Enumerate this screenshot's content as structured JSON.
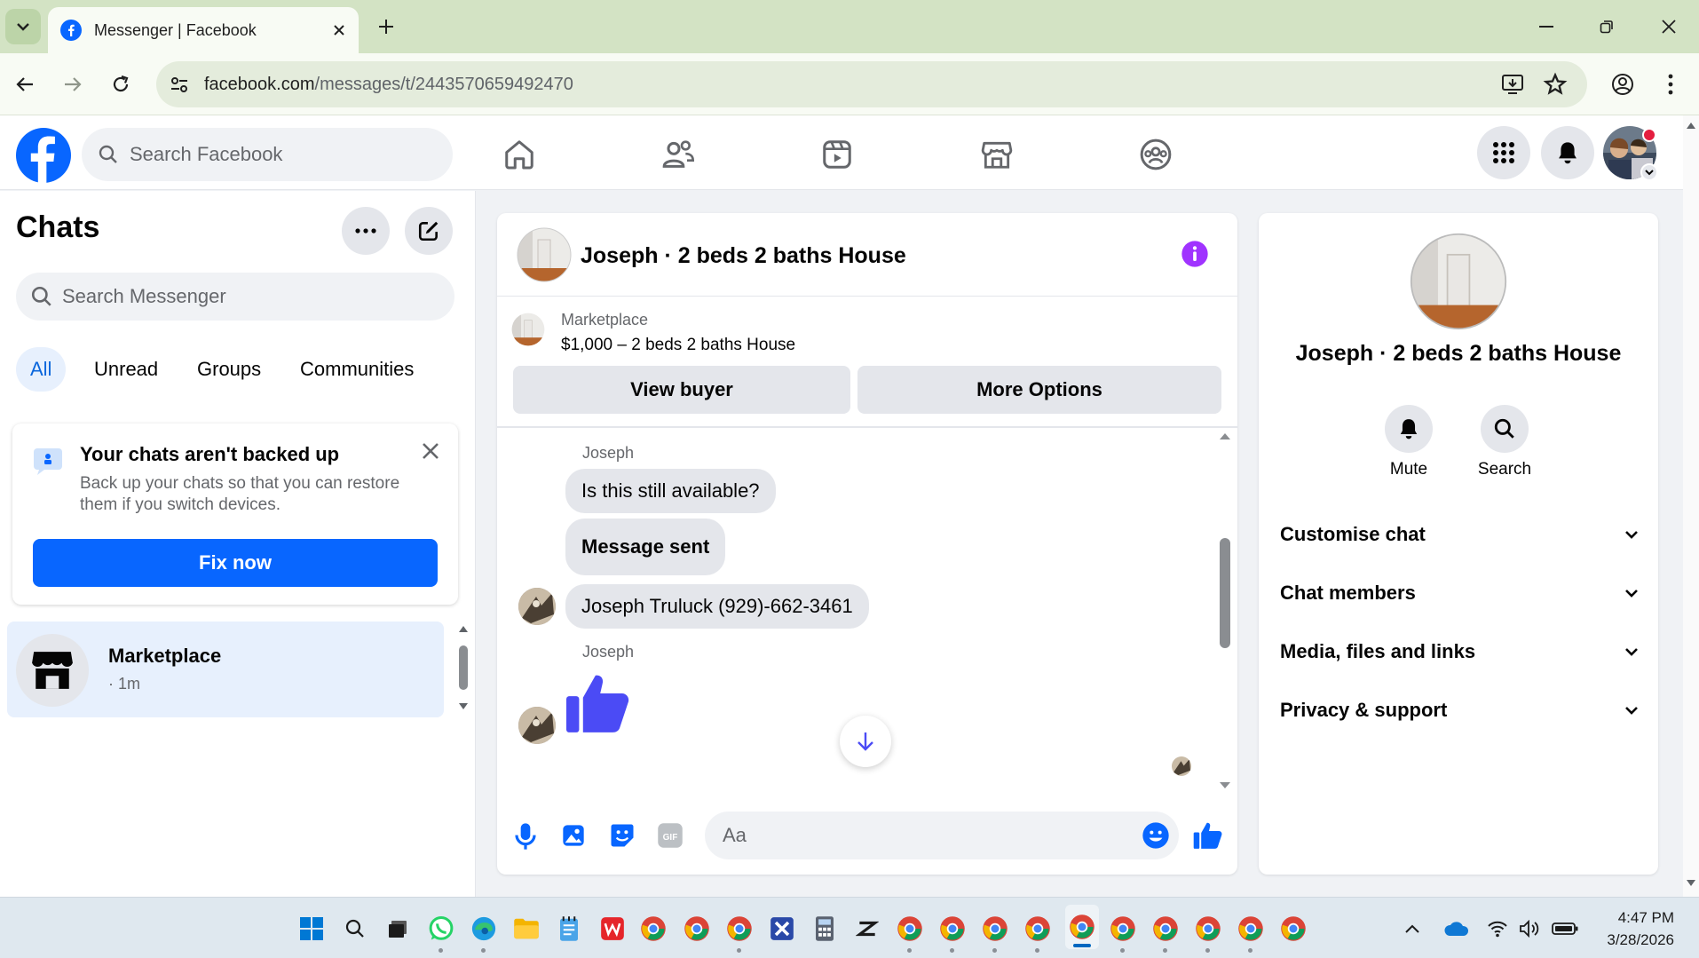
{
  "browser": {
    "tab_title": "Messenger | Facebook",
    "url_domain": "facebook.com",
    "url_path": "/messages/t/2443570659492470",
    "colors": {
      "chrome": "#d3e3c4",
      "toolbar": "#f8fbf4"
    }
  },
  "facebook": {
    "search_placeholder": "Search Facebook",
    "nav_icons": [
      "home-icon",
      "friends-icon",
      "video-icon",
      "marketplace-icon",
      "groups-icon"
    ],
    "brand_color": "#0866ff"
  },
  "sidebar": {
    "title": "Chats",
    "search_placeholder": "Search Messenger",
    "filters": [
      "All",
      "Unread",
      "Groups",
      "Communities"
    ],
    "active_filter": "All",
    "backup_card": {
      "heading": "Your chats aren't backed up",
      "description": "Back up your chats so that you can restore them if you switch devices.",
      "button": "Fix now"
    },
    "chat_items": [
      {
        "name": "Marketplace",
        "meta": "· 1m"
      }
    ]
  },
  "conversation": {
    "title": "Joseph · 2 beds 2 baths House",
    "marketplace_label": "Marketplace",
    "listing": "$1,000 – 2 beds 2 baths House",
    "view_buyer": "View buyer",
    "more_options": "More Options",
    "messages": [
      {
        "sender": "Joseph",
        "text": "Is this still available?"
      },
      {
        "sender": "",
        "text": "Message sent"
      },
      {
        "sender": "",
        "text": "Joseph Truluck (929)-662-3461"
      },
      {
        "sender": "Joseph",
        "text": "thumbs-up"
      }
    ],
    "composer_placeholder": "Aa",
    "accent_color": "#4b4bf5"
  },
  "details": {
    "name": "Joseph · 2 beds 2 baths House",
    "actions": [
      "Mute",
      "Search"
    ],
    "sections": [
      "Customise chat",
      "Chat members",
      "Media, files and links",
      "Privacy & support"
    ]
  },
  "taskbar": {
    "time": "4:47 PM",
    "date": "3/28/2026"
  }
}
